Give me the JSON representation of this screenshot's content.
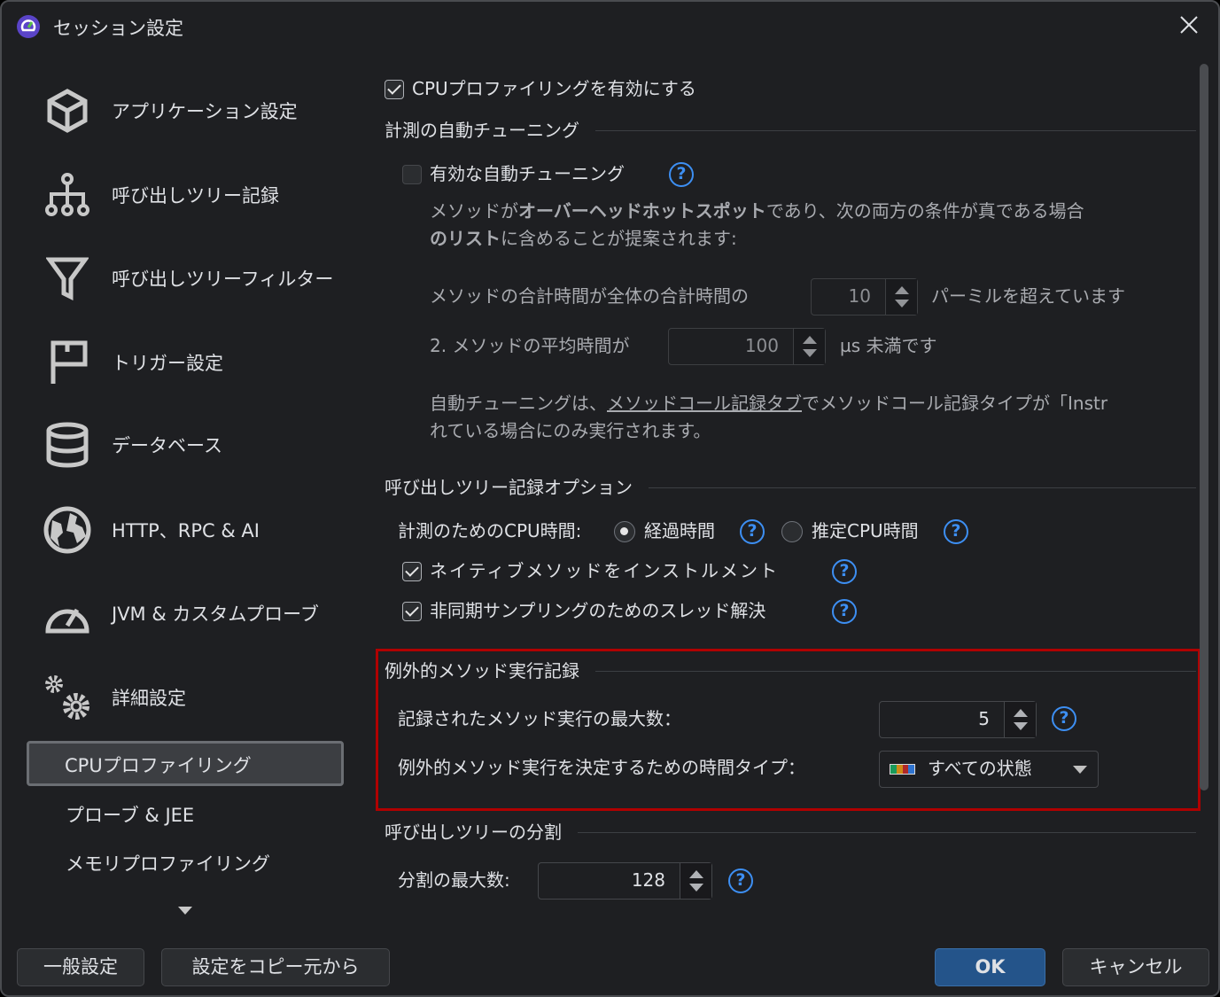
{
  "window": {
    "title": "セッション設定",
    "close_icon": "close-icon",
    "app_icon": "speedometer-app-icon"
  },
  "sidebar": {
    "items": [
      {
        "label": "アプリケーション設定",
        "icon": "cube-icon"
      },
      {
        "label": "呼び出しツリー記録",
        "icon": "tree-icon"
      },
      {
        "label": "呼び出しツリーフィルター",
        "icon": "filter-icon"
      },
      {
        "label": "トリガー設定",
        "icon": "flag-icon"
      },
      {
        "label": "データベース",
        "icon": "database-icon"
      },
      {
        "label": "HTTP、RPC & AI",
        "icon": "globe-icon"
      },
      {
        "label": "JVM & カスタムプローブ",
        "icon": "gauge-icon"
      },
      {
        "label": "詳細設定",
        "icon": "gears-icon"
      }
    ],
    "sub_items": [
      {
        "label": "CPUプロファイリング",
        "selected": true
      },
      {
        "label": "プローブ & JEE"
      },
      {
        "label": "メモリプロファイリング"
      }
    ]
  },
  "content": {
    "enable_cpu": {
      "label": "CPUプロファイリングを有効にする",
      "checked": true
    },
    "auto_tuning": {
      "section": "計測の自動チューニング",
      "enable_label": "有効な自動チューニング",
      "enabled": false,
      "desc_1a": "メソッドが",
      "desc_1b": "オーバーヘッドホットスポット",
      "desc_1c": "であり、次の両方の条件が真である場合",
      "desc_2a": "のリスト",
      "desc_2b": "に含めることが提案されます:",
      "cond1_prefix": "メソッドの合計時間が全体の合計時間の",
      "cond1_value": "10",
      "cond1_suffix": "パーミルを超えています",
      "cond2_prefix": "2. メソッドの平均時間が",
      "cond2_value": "100",
      "cond2_suffix": "µs 未満です",
      "note_a": "自動チューニングは、",
      "note_link": "メソッドコール記録タブ",
      "note_b": "でメソッドコール記録タイプが「Instr",
      "note_2": "れている場合にのみ実行されます。"
    },
    "call_tree": {
      "section": "呼び出しツリー記録オプション",
      "cpu_time_label": "計測のためのCPU時間:",
      "opt_elapsed": "経過時間",
      "opt_estimated": "推定CPU時間",
      "selected": "経過時間",
      "native_label": "ネイティブメソッドをインストルメント",
      "native_checked": true,
      "async_label": "非同期サンプリングのためのスレッド解決",
      "async_checked": true
    },
    "exceptional": {
      "section": "例外的メソッド実行記録",
      "max_label": "記録されたメソッド実行の最大数：",
      "max_value": "5",
      "time_type_label": "例外的メソッド実行を決定するための時間タイプ：",
      "time_type_value": "すべての状態",
      "highlight_color": "#b00000"
    },
    "split": {
      "section": "呼び出しツリーの分割",
      "max_label": "分割の最大数:",
      "max_value": "128"
    }
  },
  "footer": {
    "general": "一般設定",
    "copy": "設定をコピー元から",
    "ok": "OK",
    "cancel": "キャンセル"
  },
  "colors": {
    "bg": "#1e1f22",
    "accent": "#3d8ff3",
    "ok": "#24548a"
  }
}
